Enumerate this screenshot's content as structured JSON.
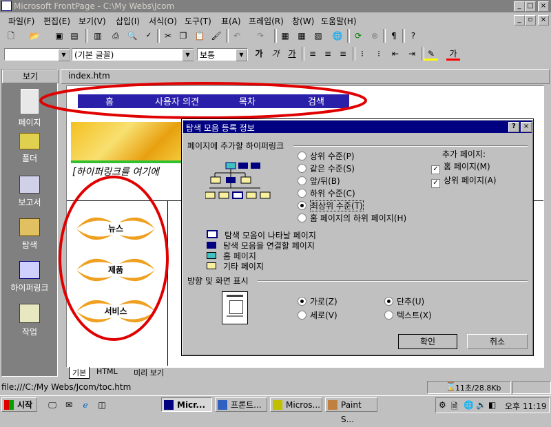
{
  "window": {
    "title": "Microsoft FrontPage - C:\\My Webs\\Jcom",
    "min": "_",
    "max": "□",
    "close": "×"
  },
  "menu": [
    "파일(F)",
    "편집(E)",
    "보기(V)",
    "삽입(I)",
    "서식(O)",
    "도구(T)",
    "표(A)",
    "프레임(R)",
    "창(W)",
    "도움말(H)"
  ],
  "format_toolbar": {
    "style_value": "",
    "font_value": "(기본 글꼴)",
    "size_value": "보통"
  },
  "views": {
    "header": "보기",
    "items": [
      {
        "label": "페이지",
        "icon": "page-icon"
      },
      {
        "label": "폴더",
        "icon": "folder-icon"
      },
      {
        "label": "보고서",
        "icon": "reports-icon"
      },
      {
        "label": "탐색",
        "icon": "navigation-icon"
      },
      {
        "label": "하이퍼링크",
        "icon": "hyperlinks-icon"
      },
      {
        "label": "작업",
        "icon": "tasks-icon"
      }
    ]
  },
  "editor": {
    "tab": "index.htm",
    "navbar_links": [
      "홈",
      "사용자 의견",
      "목차",
      "검색"
    ],
    "hyperlink_placeholder": "[하이퍼링크를 여기에",
    "cards": [
      "뉴스",
      "제품",
      "서비스"
    ],
    "view_tabs": [
      "기본",
      "HTML",
      "미리 보기"
    ]
  },
  "dialog": {
    "title": "탐색 모음 등록 정보",
    "help": "?",
    "close": "×",
    "section_hyperlinks": "페이지에 추가할 하이퍼링크",
    "levels": [
      {
        "label": "상위 수준(P)",
        "selected": false
      },
      {
        "label": "같은 수준(S)",
        "selected": false
      },
      {
        "label": "앞/뒤(B)",
        "selected": false
      },
      {
        "label": "하위 수준(C)",
        "selected": false
      },
      {
        "label": "최상위 수준(T)",
        "selected": true
      },
      {
        "label": "홈 페이지의 하위 페이지(H)",
        "selected": false
      }
    ],
    "additional_pages_label": "추가 페이지:",
    "additional_pages": [
      {
        "label": "홈 페이지(M)",
        "checked": true
      },
      {
        "label": "상위 페이지(A)",
        "checked": true
      }
    ],
    "legend": [
      "탐색 모음이 나타날 페이지",
      "탐색 모음을 연결할 페이지",
      "홈 페이지",
      "기타 페이지"
    ],
    "section_orientation": "방향 및 화면 표시",
    "orientation": [
      {
        "label": "가로(Z)",
        "selected": true
      },
      {
        "label": "세로(V)",
        "selected": false
      }
    ],
    "appearance": [
      {
        "label": "단추(U)",
        "selected": true
      },
      {
        "label": "텍스트(X)",
        "selected": false
      }
    ],
    "ok": "확인",
    "cancel": "취소"
  },
  "status": {
    "path": "file:///C:/My Webs/Jcom/toc.htm",
    "time": "11초/28.8Kb"
  },
  "taskbar": {
    "start": "시작",
    "tasks": [
      "Micr...",
      "프론트...",
      "Micros...",
      "Paint S..."
    ],
    "clock": "오후 11:19"
  },
  "colors": {
    "navbar": "#2a1fa8",
    "title_active": "#000080",
    "title_inactive": "#808080",
    "annotation": "#e00000",
    "card_swoosh": "#f0a020"
  }
}
